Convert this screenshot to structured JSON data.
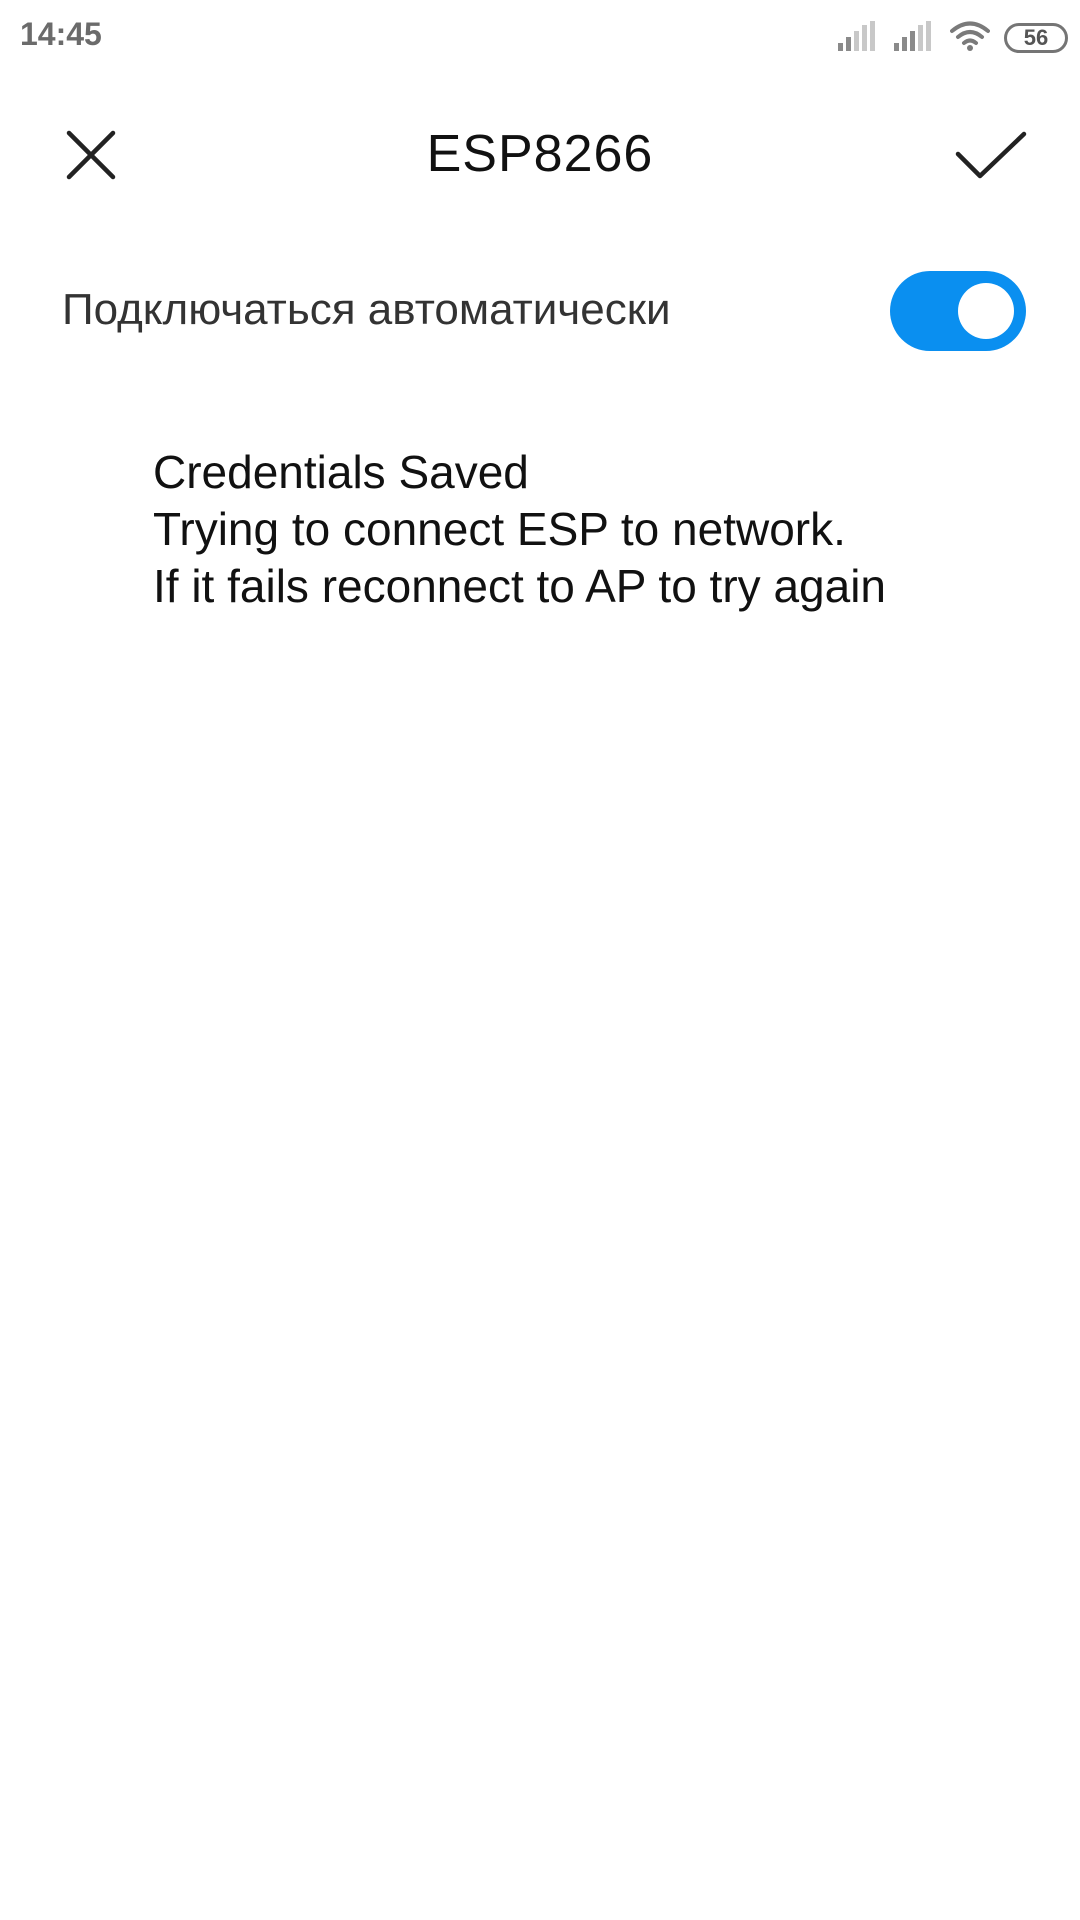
{
  "status_bar": {
    "time": "14:45",
    "battery_level": "56",
    "icons": [
      "signal-icon",
      "signal-icon",
      "wifi-icon",
      "battery-icon"
    ]
  },
  "header": {
    "title": "ESP8266",
    "close_icon": "close-icon",
    "confirm_icon": "check-icon"
  },
  "auto_connect": {
    "label": "Подключаться автоматически",
    "enabled": true
  },
  "message": {
    "lines": [
      "Credentials Saved",
      "Trying to connect ESP to network.",
      "If it fails reconnect to AP to try again"
    ]
  },
  "colors": {
    "accent": "#0a8ff0",
    "background": "#ffffff",
    "text": "#111111"
  }
}
